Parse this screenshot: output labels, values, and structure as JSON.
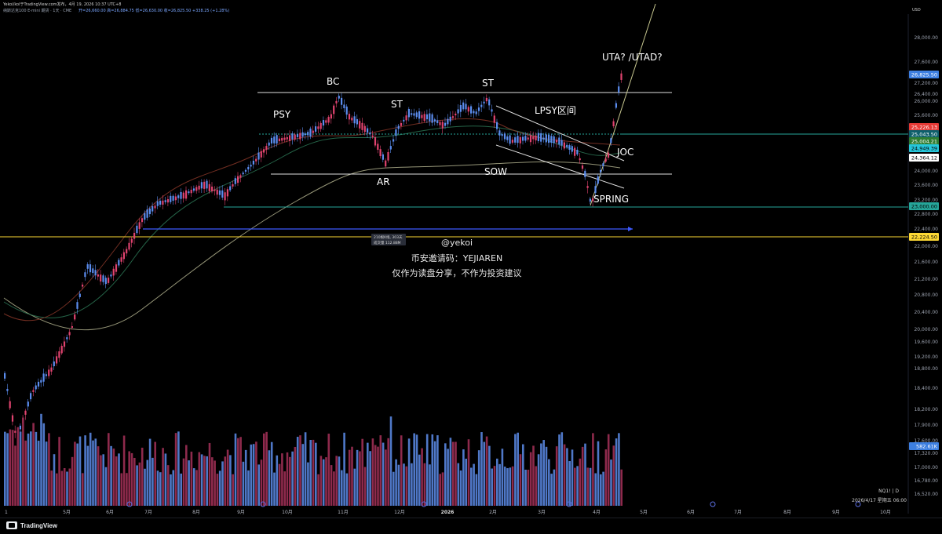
{
  "header": {
    "author_line": "Yekoi/kol于TradingView.com发布，4月 19, 2026 10:37 UTC+8",
    "symbol_line": "纳斯达克100 E-mini 期货 · 1天 · CME",
    "ohlc_line": "开=26,660.00  高=26,884.75  低=26,630.00  收=26,825.50  +338.25 (+1.28%)",
    "currency": "USD"
  },
  "price_axis": {
    "ticks": [
      "28,000.00",
      "27,600.00",
      "27,200.00",
      "26,400.00",
      "26,000.00",
      "25,600.00",
      "24,000.00",
      "23,600.00",
      "23,200.00",
      "22,800.00",
      "22,400.00",
      "22,000.00",
      "21,600.00",
      "21,200.00",
      "20,800.00",
      "20,400.00",
      "20,000.00",
      "19,600.00",
      "19,200.00",
      "18,800.00",
      "18,400.00",
      "18,200.00",
      "17,900.00",
      "17,600.00",
      "17,320.00",
      "17,000.00",
      "16,780.00",
      "16,520.00"
    ],
    "badges": [
      {
        "label": "26,825.50",
        "bg": "#3d7fe0",
        "fg": "#ffffff"
      },
      {
        "label": "25,226.13",
        "bg": "#e53935",
        "fg": "#ffffff"
      },
      {
        "label": "25,043.50",
        "bg": "#0e5f6b",
        "fg": "#ffffff"
      },
      {
        "label": "25,004.21",
        "bg": "#2e7d32",
        "fg": "#ffffff"
      },
      {
        "label": "24,949.39",
        "bg": "#26c6da",
        "fg": "#000000"
      },
      {
        "label": "24,364.12",
        "bg": "#ffffff",
        "fg": "#000000"
      },
      {
        "label": "23,000.00",
        "bg": "#26a69a",
        "fg": "#000000"
      },
      {
        "label": "22,224.50",
        "bg": "#fdd835",
        "fg": "#000000"
      },
      {
        "label": "582.61K",
        "bg": "#3d7fe0",
        "fg": "#ffffff"
      }
    ]
  },
  "time_axis": {
    "labels": [
      "5月",
      "6月",
      "7月",
      "8月",
      "9月",
      "10月",
      "11月",
      "12月",
      "2026",
      "2月",
      "3月",
      "4月",
      "5月",
      "6月",
      "7月",
      "8月",
      "9月",
      "10月"
    ],
    "first": "1"
  },
  "annotations": {
    "psy": "PSY",
    "bc": "BC",
    "st1": "ST",
    "st2": "ST",
    "ar": "AR",
    "lpsy": "LPSY区间",
    "sow": "SOW",
    "joc": "JOC",
    "spring": "SPRING",
    "uta": "UTA?  /UTAD?"
  },
  "watermark": {
    "handle": "@yekoi",
    "invite": "币安邀请码：YEJIAREN",
    "disclaimer": "仅作为读盘分享，不作为投资建议"
  },
  "measure_box": {
    "line1": "210根K线, 303天",
    "line2": "成交量 112.88M"
  },
  "symbol_info": {
    "ticker": "NQ1! | D",
    "datetime": "2026/4/17 星期五 06:00"
  },
  "footer": {
    "brand": "TradingView"
  },
  "colors": {
    "up": "#5b8def",
    "down": "#e0436f",
    "vol_up": "#4f78c8",
    "vol_down": "#8e2a4c",
    "ma": "#c8c8a0"
  }
}
